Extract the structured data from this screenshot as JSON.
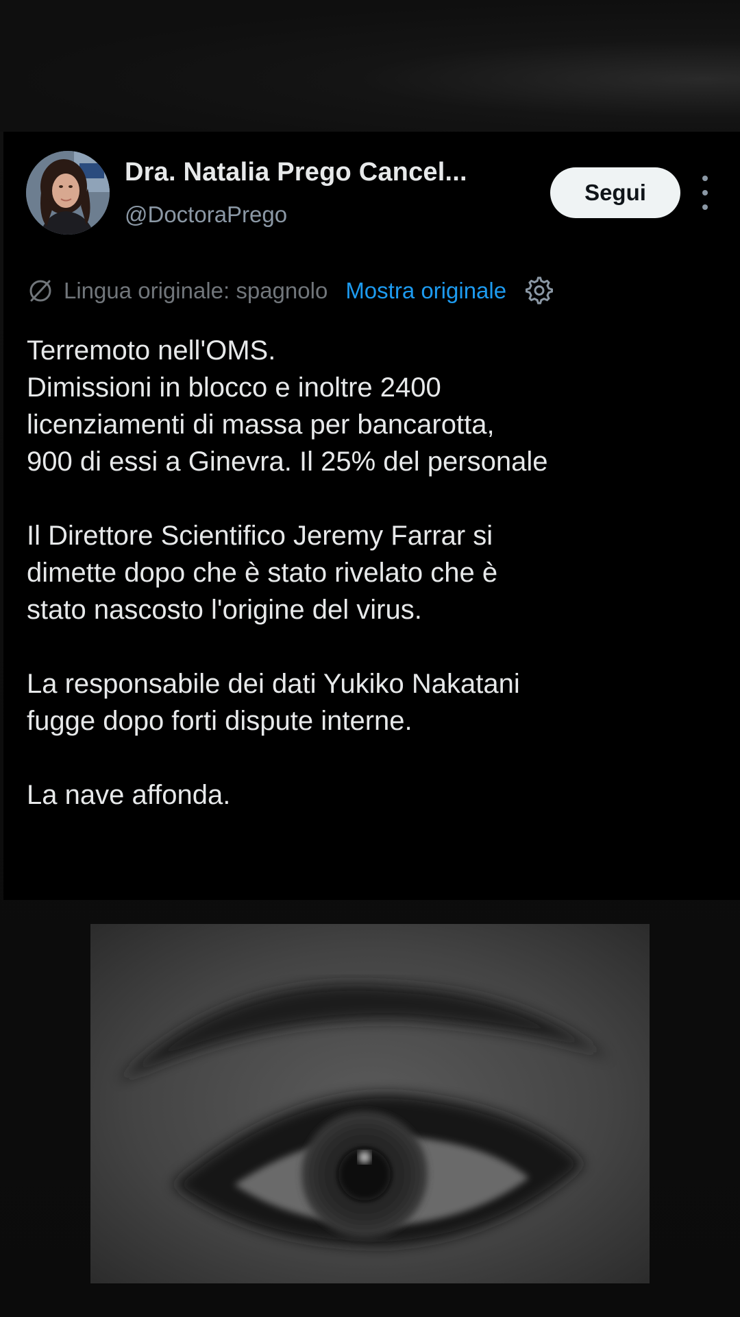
{
  "tweet": {
    "author": {
      "display_name": "Dra. Natalia Prego Cancel...",
      "handle": "@DoctoraPrego",
      "avatar_icon": "avatar-photo"
    },
    "follow_button_label": "Segui",
    "more_icon": "more-vertical-icon",
    "translation": {
      "icon": "translate-icon",
      "label": "Lingua originale: spagnolo",
      "show_original_label": "Mostra originale",
      "settings_icon": "gear-icon"
    },
    "lines": [
      "Terremoto nell'OMS.",
      "Dimissioni in blocco e inoltre 2400",
      "licenziamenti di massa per bancarotta,",
      "900 di essi a Ginevra. Il 25% del personale",
      "Il Direttore Scientifico Jeremy Farrar si",
      "dimette dopo che è stato rivelato che è",
      "stato nascosto l'origine del virus.",
      "La responsabile dei dati Yukiko Nakatani",
      "fugge dopo forti dispute interne.",
      "La nave affonda."
    ]
  },
  "colors": {
    "card_background": "#000000",
    "text_primary": "#e7e9ea",
    "text_secondary": "#71767b",
    "link_blue": "#1d9bf0",
    "button_background": "#eff3f4"
  },
  "media": {
    "icon": "eye-closeup-image"
  }
}
